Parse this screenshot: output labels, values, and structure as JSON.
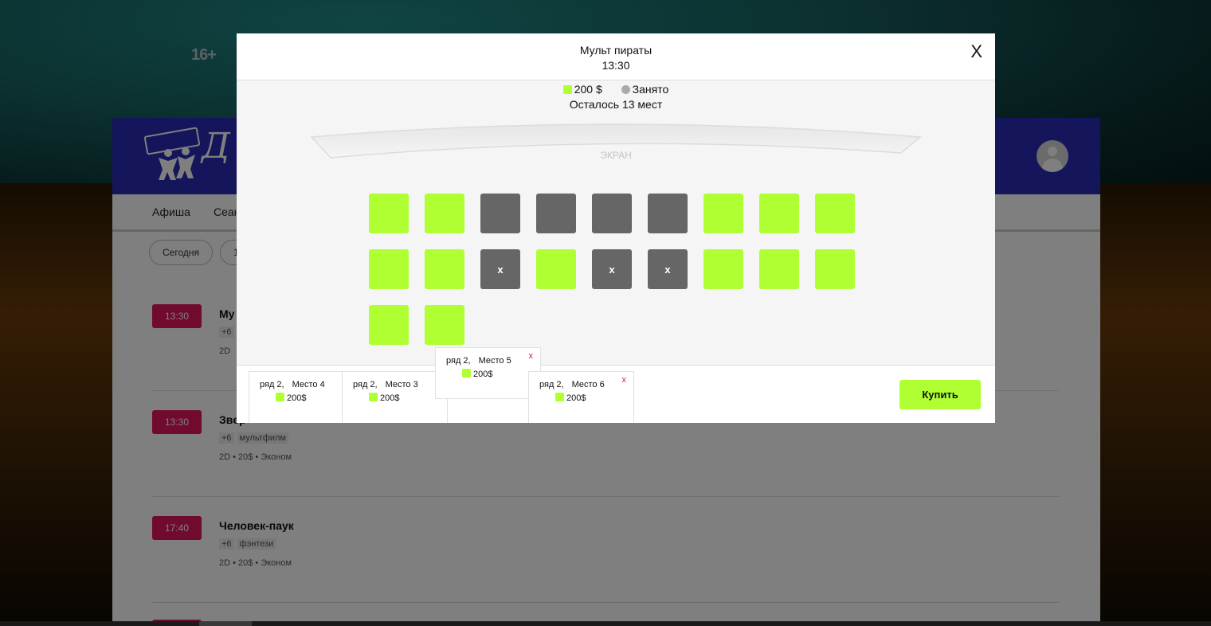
{
  "background": {
    "rating": "16+"
  },
  "site": {
    "logo_text": "Д",
    "nav": [
      "Афиша",
      "Сеан"
    ],
    "dates": [
      "Сегодня",
      "1"
    ]
  },
  "sessions": [
    {
      "time": "13:30",
      "title": "Му",
      "tags": [
        "+6"
      ],
      "meta": "2D"
    },
    {
      "time": "13:30",
      "title": "Звер",
      "tags": [
        "+6",
        "мультфилм"
      ],
      "meta": "2D  •  20$  •  Эконом"
    },
    {
      "time": "17:40",
      "title": "Человек-паук",
      "tags": [
        "+6",
        "фэнтези"
      ],
      "meta": "2D  •  20$  •  Эконом"
    }
  ],
  "modal": {
    "title": "Мульт пираты",
    "time": "13:30",
    "close": "X",
    "legend_price": "200 $",
    "legend_taken": "Занято",
    "remaining": "Осталось 13 мест",
    "screen_label": "ЭКРАН",
    "seats": [
      {
        "row": 1,
        "state": "free",
        "mark": ""
      },
      {
        "row": 1,
        "state": "free",
        "mark": ""
      },
      {
        "row": 1,
        "state": "taken",
        "mark": ""
      },
      {
        "row": 1,
        "state": "taken",
        "mark": ""
      },
      {
        "row": 1,
        "state": "taken",
        "mark": ""
      },
      {
        "row": 1,
        "state": "taken",
        "mark": ""
      },
      {
        "row": 1,
        "state": "free",
        "mark": ""
      },
      {
        "row": 1,
        "state": "free",
        "mark": ""
      },
      {
        "row": 1,
        "state": "free",
        "mark": ""
      },
      {
        "row": 2,
        "state": "free",
        "mark": ""
      },
      {
        "row": 2,
        "state": "free",
        "mark": ""
      },
      {
        "row": 2,
        "state": "taken",
        "mark": "x"
      },
      {
        "row": 2,
        "state": "free",
        "mark": ""
      },
      {
        "row": 2,
        "state": "taken",
        "mark": "x"
      },
      {
        "row": 2,
        "state": "taken",
        "mark": "x"
      },
      {
        "row": 2,
        "state": "free",
        "mark": ""
      },
      {
        "row": 2,
        "state": "free",
        "mark": ""
      },
      {
        "row": 2,
        "state": "free",
        "mark": ""
      },
      {
        "row": 3,
        "state": "free",
        "mark": ""
      },
      {
        "row": 3,
        "state": "free",
        "mark": ""
      }
    ],
    "tickets": [
      {
        "row": "ряд 2,",
        "seat": "Место 4",
        "price": "200$",
        "close": ""
      },
      {
        "row": "ряд 2,",
        "seat": "Место 3",
        "price": "200$",
        "close": ""
      },
      {
        "row": "ряд 2,",
        "seat": "Место 5",
        "price": "200$",
        "close": "x"
      },
      {
        "row": "ряд 2,",
        "seat": "Место 6",
        "price": "200$",
        "close": "x"
      }
    ],
    "buy_label": "Купить"
  },
  "colors": {
    "free": "#afff33",
    "taken": "#666666",
    "accent": "#e0155f",
    "header": "#2a2ab8"
  }
}
